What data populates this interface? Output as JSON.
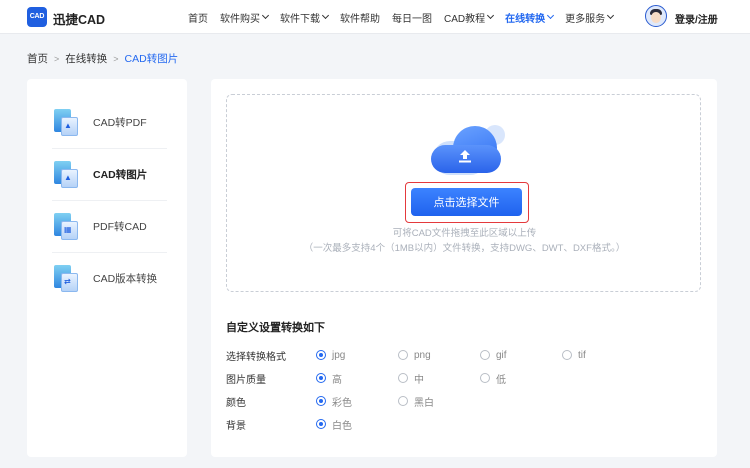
{
  "header": {
    "logo_text": "CAD",
    "brand": "迅捷CAD",
    "nav": [
      {
        "label": "首页",
        "chevron": false,
        "active": false
      },
      {
        "label": "软件购买",
        "chevron": true,
        "active": false
      },
      {
        "label": "软件下载",
        "chevron": true,
        "active": false
      },
      {
        "label": "软件帮助",
        "chevron": false,
        "active": false
      },
      {
        "label": "每日一图",
        "chevron": false,
        "active": false
      },
      {
        "label": "CAD教程",
        "chevron": true,
        "active": false
      },
      {
        "label": "在线转换",
        "chevron": true,
        "active": true
      },
      {
        "label": "更多服务",
        "chevron": true,
        "active": false
      }
    ],
    "login": "登录/注册"
  },
  "breadcrumb": {
    "items": [
      "首页",
      "在线转换",
      "CAD转图片"
    ],
    "sep": ">"
  },
  "sidebar": {
    "items": [
      {
        "label": "CAD转PDF",
        "icon": "cad-to-pdf-icon",
        "glyph": "▲",
        "active": false
      },
      {
        "label": "CAD转图片",
        "icon": "cad-to-image-icon",
        "glyph": "▲",
        "active": true
      },
      {
        "label": "PDF转CAD",
        "icon": "pdf-to-cad-icon",
        "glyph": "▦",
        "active": false
      },
      {
        "label": "CAD版本转换",
        "icon": "cad-version-icon",
        "glyph": "⇄",
        "active": false
      }
    ]
  },
  "upload": {
    "button": "点击选择文件",
    "hint1": "可将CAD文件拖拽至此区域以上传",
    "hint2": "（一次最多支持4个（1MB以内）文件转换，支持DWG、DWT、DXF格式。）"
  },
  "settings": {
    "title": "自定义设置转换如下",
    "rows": [
      {
        "label": "选择转换格式",
        "options": [
          "jpg",
          "png",
          "gif",
          "tif"
        ],
        "selected": 0
      },
      {
        "label": "图片质量",
        "options": [
          "高",
          "中",
          "低"
        ],
        "selected": 0
      },
      {
        "label": "颜色",
        "options": [
          "彩色",
          "黑白"
        ],
        "selected": 0
      },
      {
        "label": "背景",
        "options": [
          "白色"
        ],
        "selected": 0
      }
    ]
  },
  "colors": {
    "accent": "#2469f0",
    "highlight": "#e4393c"
  }
}
